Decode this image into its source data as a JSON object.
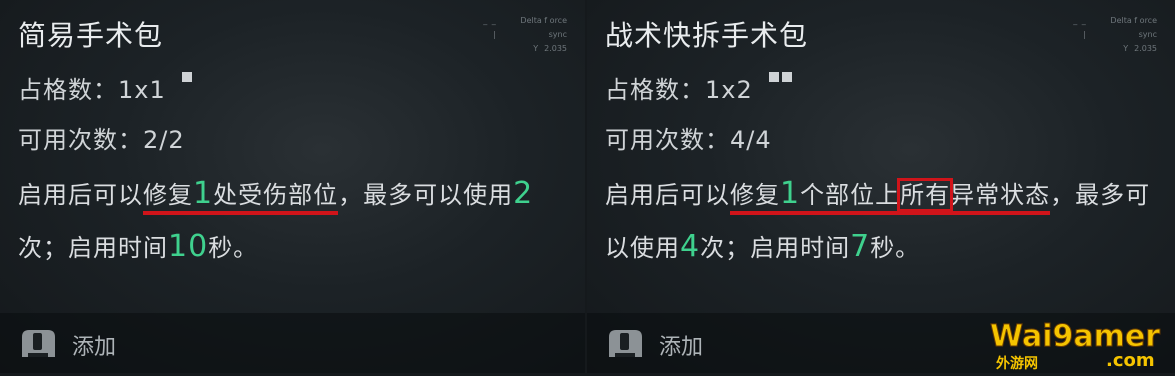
{
  "cards": [
    {
      "title": "简易手术包",
      "sync_line1": "Delta f orce sync",
      "sync_line2": "2.035",
      "sync_prefix2": "Y",
      "grid_label": "占格数：",
      "grid_value": "1x1",
      "uses_label": "可用次数：",
      "uses_value": "2/2",
      "desc": {
        "p1": "启用后可以",
        "u1": "修复",
        "u2": "1",
        "u3": "处受伤部位",
        "p2": "，最多可以使用",
        "n2": "2",
        "p3": "次；启用时间",
        "n3": "10",
        "p4": "秒。"
      },
      "add_label": "添加"
    },
    {
      "title": "战术快拆手术包",
      "sync_line1": "Delta f orce sync",
      "sync_line2": "2.035",
      "sync_prefix2": "Y",
      "grid_label": "占格数：",
      "grid_value": "1x2",
      "uses_label": "可用次数：",
      "uses_value": "4/4",
      "desc": {
        "p1": "启用后可以",
        "u1": "修复",
        "u2": "1",
        "u3": "个部位上",
        "box": "所有",
        "u4": "异常状态",
        "p2": "，最多可以使用",
        "n2": "4",
        "p3": "次；启用时间",
        "n3": "7",
        "p4": "秒。"
      },
      "add_label": "添加"
    }
  ],
  "watermark": {
    "text_main": "Wai9amer",
    "text_sub": "外游网",
    "text_com": ".com"
  },
  "colors": {
    "accent_green": "#3fd18e",
    "highlight_red": "#d0141a"
  }
}
